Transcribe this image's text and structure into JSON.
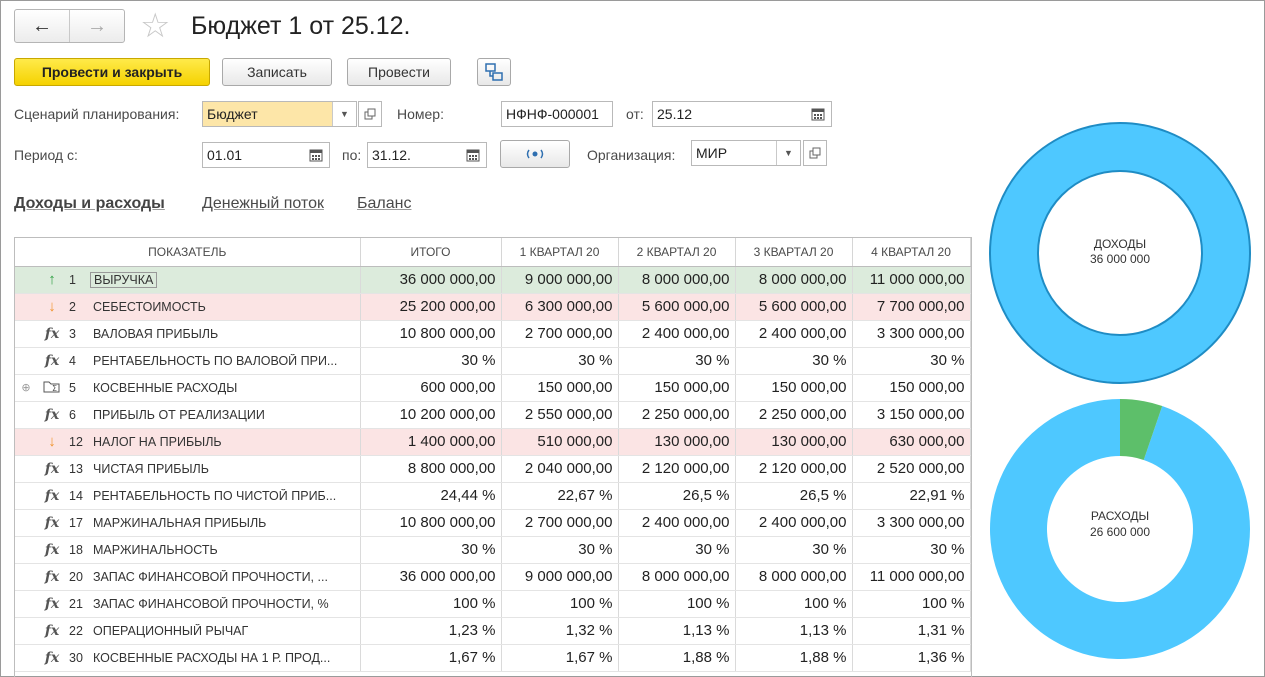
{
  "window": {
    "title": "Бюджет 1 от 25.12."
  },
  "nav": {
    "back_icon": "←",
    "forward_icon": "→",
    "star_icon": "☆"
  },
  "toolbar": {
    "post_close_label": "Провести и закрыть",
    "save_label": "Записать",
    "post_label": "Провести"
  },
  "form": {
    "scenario_label": "Сценарий планирования:",
    "scenario_value": "Бюджет",
    "number_label": "Номер:",
    "number_value": "НФНФ-000001",
    "date_from_label": "от:",
    "date_value": "25.12",
    "period_label": "Период с:",
    "period_from_value": "01.01",
    "period_to_label": "по:",
    "period_to_value": "31.12.",
    "org_label": "Организация:",
    "org_value": "МИР"
  },
  "tabs": [
    {
      "label": "Доходы и расходы",
      "active": true
    },
    {
      "label": "Денежный поток",
      "active": false
    },
    {
      "label": "Баланс",
      "active": false
    }
  ],
  "table": {
    "headers": [
      "ПОКАЗАТЕЛЬ",
      "ИТОГО",
      "1 КВАРТАЛ 20",
      "2 КВАРТАЛ 20",
      "3 КВАРТАЛ 20",
      "4 КВАРТАЛ 20"
    ],
    "rows": [
      {
        "icon": "arrow-up-icon",
        "num": "1",
        "name": "ВЫРУЧКА",
        "total": "36 000 000,00",
        "q1": "9 000 000,00",
        "q2": "8 000 000,00",
        "q3": "8 000 000,00",
        "q4": "11 000 000,00",
        "style": "green"
      },
      {
        "icon": "arrow-down-icon",
        "num": "2",
        "name": "СЕБЕСТОИМОСТЬ",
        "total": "25 200 000,00",
        "q1": "6 300 000,00",
        "q2": "5 600 000,00",
        "q3": "5 600 000,00",
        "q4": "7 700 000,00",
        "style": "pink"
      },
      {
        "icon": "fx-icon",
        "num": "3",
        "name": "ВАЛОВАЯ ПРИБЫЛЬ",
        "total": "10 800 000,00",
        "q1": "2 700 000,00",
        "q2": "2 400 000,00",
        "q3": "2 400 000,00",
        "q4": "3 300 000,00",
        "style": ""
      },
      {
        "icon": "fx-icon",
        "num": "4",
        "name": "РЕНТАБЕЛЬНОСТЬ ПО ВАЛОВОЙ ПРИ...",
        "total": "30 %",
        "q1": "30 %",
        "q2": "30 %",
        "q3": "30 %",
        "q4": "30 %",
        "style": ""
      },
      {
        "icon": "folder-sum-icon",
        "num": "5",
        "name": "КОСВЕННЫЕ РАСХОДЫ",
        "total": "600 000,00",
        "q1": "150 000,00",
        "q2": "150 000,00",
        "q3": "150 000,00",
        "q4": "150 000,00",
        "style": "",
        "expandable": true
      },
      {
        "icon": "fx-icon",
        "num": "6",
        "name": "ПРИБЫЛЬ ОТ РЕАЛИЗАЦИИ",
        "total": "10 200 000,00",
        "q1": "2 550 000,00",
        "q2": "2 250 000,00",
        "q3": "2 250 000,00",
        "q4": "3 150 000,00",
        "style": ""
      },
      {
        "icon": "arrow-down-icon",
        "num": "12",
        "name": "НАЛОГ НА ПРИБЫЛЬ",
        "total": "1 400 000,00",
        "q1": "510 000,00",
        "q2": "130 000,00",
        "q3": "130 000,00",
        "q4": "630 000,00",
        "style": "pink"
      },
      {
        "icon": "fx-icon",
        "num": "13",
        "name": "ЧИСТАЯ ПРИБЫЛЬ",
        "total": "8 800 000,00",
        "q1": "2 040 000,00",
        "q2": "2 120 000,00",
        "q3": "2 120 000,00",
        "q4": "2 520 000,00",
        "style": ""
      },
      {
        "icon": "fx-icon",
        "num": "14",
        "name": "РЕНТАБЕЛЬНОСТЬ ПО ЧИСТОЙ ПРИБ...",
        "total": "24,44 %",
        "q1": "22,67 %",
        "q2": "26,5 %",
        "q3": "26,5 %",
        "q4": "22,91 %",
        "style": ""
      },
      {
        "icon": "fx-icon",
        "num": "17",
        "name": "МАРЖИНАЛЬНАЯ ПРИБЫЛЬ",
        "total": "10 800 000,00",
        "q1": "2 700 000,00",
        "q2": "2 400 000,00",
        "q3": "2 400 000,00",
        "q4": "3 300 000,00",
        "style": ""
      },
      {
        "icon": "fx-icon",
        "num": "18",
        "name": "МАРЖИНАЛЬНОСТЬ",
        "total": "30 %",
        "q1": "30 %",
        "q2": "30 %",
        "q3": "30 %",
        "q4": "30 %",
        "style": ""
      },
      {
        "icon": "fx-icon",
        "num": "20",
        "name": "ЗАПАС ФИНАНСОВОЙ ПРОЧНОСТИ, ...",
        "total": "36 000 000,00",
        "q1": "9 000 000,00",
        "q2": "8 000 000,00",
        "q3": "8 000 000,00",
        "q4": "11 000 000,00",
        "style": ""
      },
      {
        "icon": "fx-icon",
        "num": "21",
        "name": "ЗАПАС ФИНАНСОВОЙ ПРОЧНОСТИ, %",
        "total": "100 %",
        "q1": "100 %",
        "q2": "100 %",
        "q3": "100 %",
        "q4": "100 %",
        "style": ""
      },
      {
        "icon": "fx-icon",
        "num": "22",
        "name": "ОПЕРАЦИОННЫЙ РЫЧАГ",
        "total": "1,23 %",
        "q1": "1,32 %",
        "q2": "1,13 %",
        "q3": "1,13 %",
        "q4": "1,31 %",
        "style": ""
      },
      {
        "icon": "fx-icon",
        "num": "30",
        "name": "КОСВЕННЫЕ РАСХОДЫ НА 1 Р. ПРОД...",
        "total": "1,67 %",
        "q1": "1,67 %",
        "q2": "1,88 %",
        "q3": "1,88 %",
        "q4": "1,36 %",
        "style": ""
      }
    ]
  },
  "chart_data": [
    {
      "type": "pie",
      "center_label": "ДОХОДЫ",
      "center_value": "36 000 000",
      "slices": [
        {
          "value": 36000000,
          "color": "#4ec8ff"
        }
      ]
    },
    {
      "type": "pie",
      "center_label": "РАСХОДЫ",
      "center_value": "26 600 000",
      "slices": [
        {
          "value": 25200000,
          "color": "#4ec8ff"
        },
        {
          "value": 1400000,
          "color": "#5dbf6a"
        }
      ]
    }
  ],
  "colors": {
    "primary_button": "#f5d200",
    "row_income": "#dcebdc",
    "row_expense": "#fbe4e4",
    "donut_blue": "#4ec8ff",
    "donut_green": "#5dbf6a"
  }
}
